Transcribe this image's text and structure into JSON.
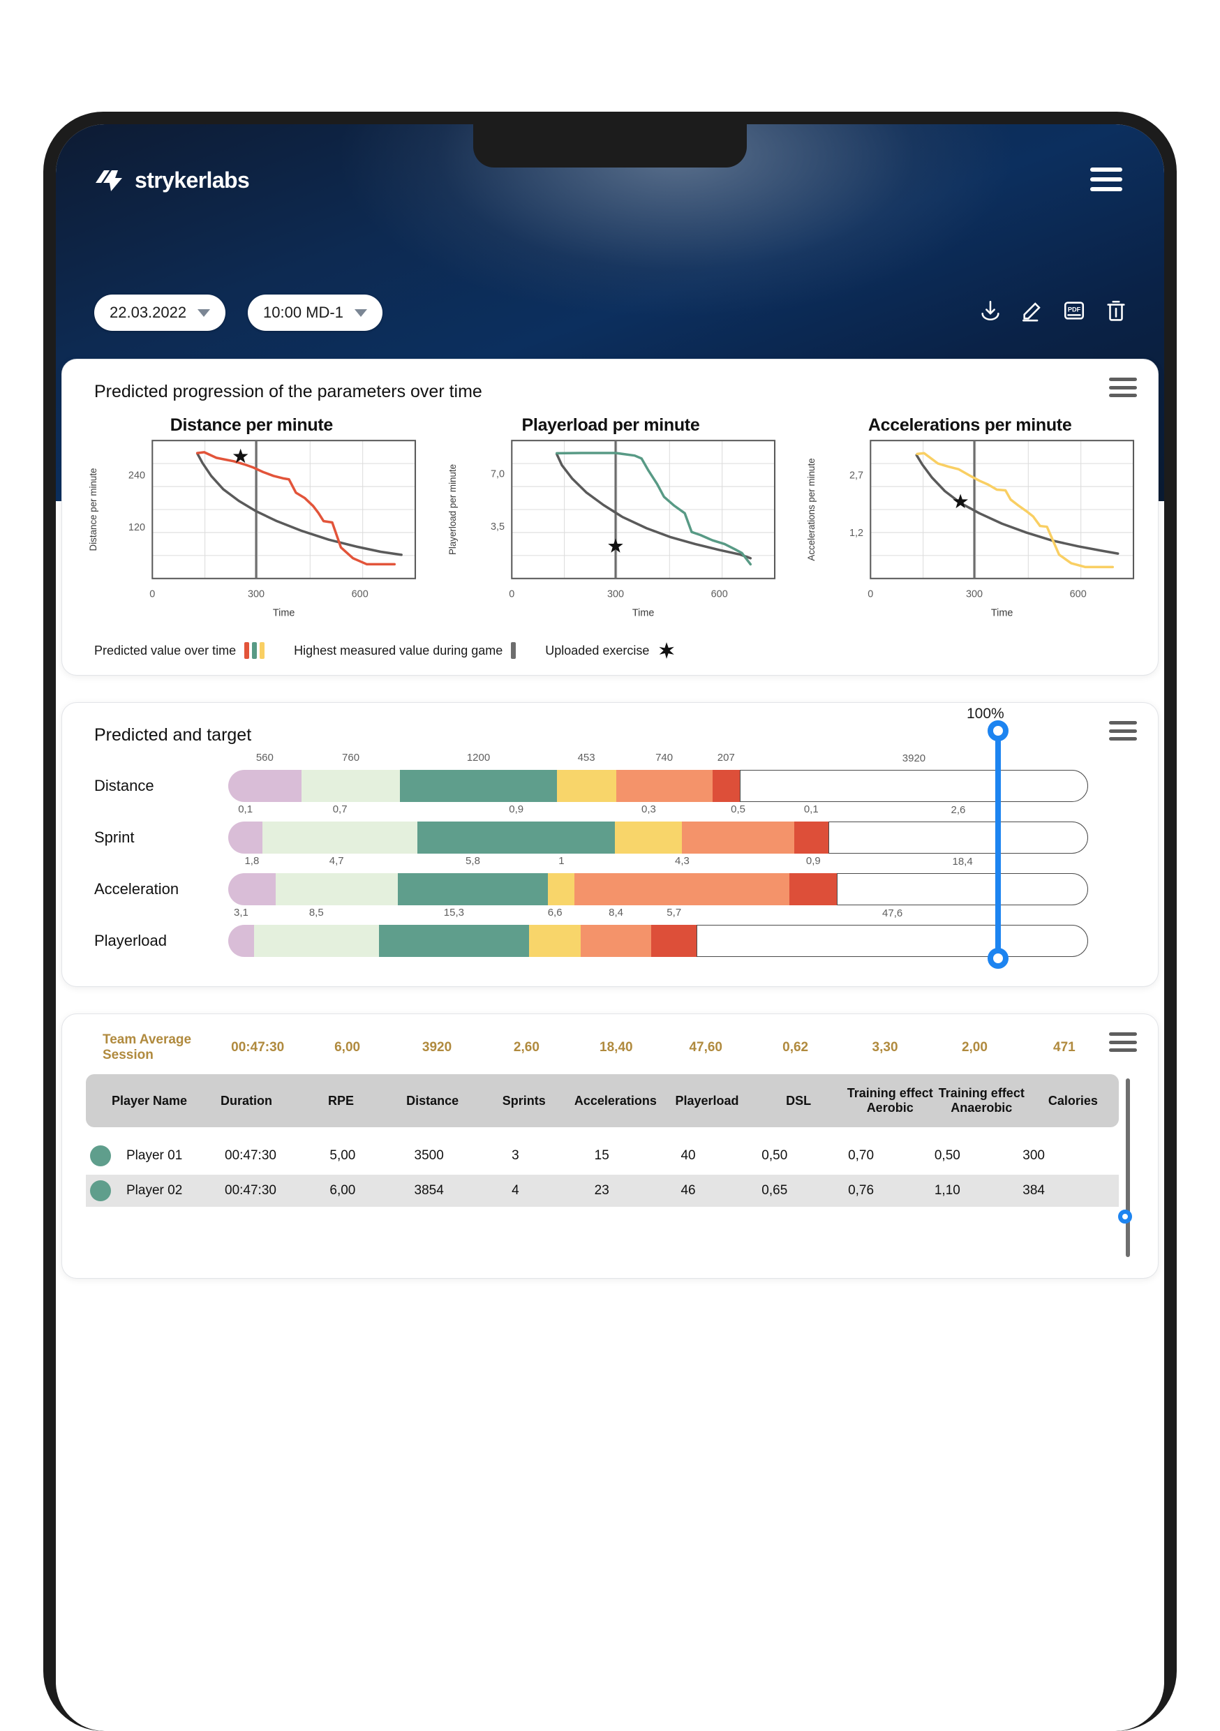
{
  "brand": {
    "name": "strykerlabs",
    "logo_icon": "lightning-bolt-icon"
  },
  "header": {
    "menu_icon": "hamburger-menu-icon",
    "date_select": "22.03.2022",
    "session_select": "10:00 MD-1",
    "toolbar": [
      {
        "name": "download-icon",
        "label": "Download"
      },
      {
        "name": "edit-pencil-icon",
        "label": "Edit"
      },
      {
        "name": "pdf-export-icon",
        "label": "PDF"
      },
      {
        "name": "trash-delete-icon",
        "label": "Delete"
      }
    ]
  },
  "charts_card": {
    "title": "Predicted progression of the parameters over time",
    "menu_icon": "hamburger-menu-icon",
    "legend": [
      {
        "label": "Predicted value over time",
        "icon": "three-color-bars-icon"
      },
      {
        "label": "Highest measured value during game",
        "icon": "grey-bar-icon"
      },
      {
        "label": "Uploaded exercise",
        "icon": "star-icon"
      }
    ]
  },
  "chart_data": [
    {
      "type": "line",
      "title": "Distance per minute",
      "xlabel": "Time",
      "ylabel": "Distance per minute",
      "xticks": [
        0,
        300,
        600
      ],
      "yticks": [
        120,
        240
      ],
      "xlim": [
        0,
        760
      ],
      "ylim": [
        0,
        320
      ],
      "grid": true,
      "marker_x": 300,
      "star": {
        "x": 255,
        "y": 283
      },
      "series": [
        {
          "name": "Predicted value over time",
          "color": "#e2543a",
          "x": [
            130,
            150,
            185,
            210,
            235,
            265,
            290,
            320,
            350,
            380,
            395,
            415,
            440,
            465,
            480,
            495,
            520,
            545,
            580,
            620,
            700
          ],
          "y": [
            291,
            293,
            280,
            276,
            272,
            265,
            258,
            247,
            238,
            232,
            230,
            199,
            187,
            168,
            152,
            133,
            130,
            72,
            47,
            33,
            33
          ]
        },
        {
          "name": "Highest measured value during game",
          "color": "#5a5a5a",
          "x": [
            130,
            145,
            170,
            205,
            250,
            300,
            360,
            430,
            510,
            590,
            660,
            720
          ],
          "y": [
            290,
            268,
            238,
            207,
            180,
            156,
            133,
            111,
            90,
            74,
            62,
            55
          ]
        }
      ]
    },
    {
      "type": "line",
      "title": "Playerload per minute",
      "xlabel": "Time",
      "ylabel": "Playerload per minute",
      "xticks": [
        0,
        300,
        600
      ],
      "yticks": [
        3.5,
        7.0
      ],
      "ytick_labels": [
        "3,5",
        "7,0"
      ],
      "xlim": [
        0,
        760
      ],
      "ylim": [
        0,
        9.2
      ],
      "grid": true,
      "marker_x": 300,
      "star": {
        "x": 300,
        "y": 2.15
      },
      "series": [
        {
          "name": "Predicted value over time",
          "color": "#589a85",
          "x": [
            130,
            200,
            300,
            355,
            375,
            395,
            420,
            440,
            470,
            500,
            520,
            545,
            580,
            615,
            645,
            665,
            690
          ],
          "y": [
            8.35,
            8.37,
            8.37,
            8.2,
            8.0,
            7.2,
            6.3,
            5.45,
            4.85,
            4.35,
            3.1,
            2.9,
            2.55,
            2.3,
            1.95,
            1.7,
            0.95
          ]
        },
        {
          "name": "Highest measured value during game",
          "color": "#5a5a5a",
          "x": [
            130,
            145,
            175,
            215,
            265,
            320,
            390,
            460,
            530,
            600,
            660,
            690
          ],
          "y": [
            8.3,
            7.55,
            6.65,
            5.75,
            4.9,
            4.1,
            3.35,
            2.75,
            2.3,
            1.9,
            1.6,
            1.35
          ]
        }
      ]
    },
    {
      "type": "line",
      "title": "Accelerations per minute",
      "xlabel": "Time",
      "ylabel": "Accelerations per minute",
      "xticks": [
        0,
        300,
        600
      ],
      "yticks": [
        1.2,
        2.7
      ],
      "ytick_labels": [
        "1,2",
        "2,7"
      ],
      "xlim": [
        0,
        760
      ],
      "ylim": [
        0,
        3.6
      ],
      "grid": true,
      "marker_x": 300,
      "star": {
        "x": 260,
        "y": 2.0
      },
      "series": [
        {
          "name": "Predicted value over time",
          "color": "#f9cf63",
          "x": [
            135,
            155,
            195,
            225,
            255,
            290,
            315,
            340,
            365,
            390,
            405,
            425,
            450,
            470,
            490,
            510,
            545,
            580,
            620,
            700
          ],
          "y": [
            3.25,
            3.27,
            3.0,
            2.92,
            2.85,
            2.67,
            2.55,
            2.45,
            2.32,
            2.3,
            2.06,
            1.92,
            1.76,
            1.62,
            1.37,
            1.35,
            0.62,
            0.4,
            0.3,
            0.3
          ]
        },
        {
          "name": "Highest measured value during game",
          "color": "#5a5a5a",
          "x": [
            133,
            150,
            178,
            215,
            260,
            315,
            380,
            450,
            525,
            600,
            665,
            715
          ],
          "y": [
            3.22,
            2.97,
            2.63,
            2.28,
            1.97,
            1.7,
            1.43,
            1.2,
            0.99,
            0.84,
            0.73,
            0.65
          ]
        }
      ]
    }
  ],
  "target_card": {
    "title": "Predicted and target",
    "menu_icon": "hamburger-menu-icon",
    "percent_label": "100%",
    "slider_name": "target-percent-slider",
    "colors": {
      "lilac": "#d9bdd7",
      "pale_green": "#e4f0dd",
      "green": "#5f9e8c",
      "yellow": "#f8d56a",
      "orange": "#f4936a",
      "red": "#dd4f39",
      "empty": "#ffffff"
    },
    "rows": [
      {
        "label": "Distance",
        "segments": [
          {
            "value": "560",
            "color": "lilac",
            "width": 8.5
          },
          {
            "value": "760",
            "color": "pale_green",
            "width": 11.5
          },
          {
            "value": "1200",
            "color": "green",
            "width": 18.2
          },
          {
            "value": "453",
            "color": "yellow",
            "width": 6.9
          },
          {
            "value": "740",
            "color": "orange",
            "width": 11.2
          },
          {
            "value": "207",
            "color": "red",
            "width": 3.2
          },
          {
            "value": "3920",
            "color": "empty",
            "width": 40.5
          }
        ]
      },
      {
        "label": "Sprint",
        "segments": [
          {
            "value": "0,1",
            "color": "lilac",
            "width": 4.0
          },
          {
            "value": "0,7",
            "color": "pale_green",
            "width": 18.0
          },
          {
            "value": "0,9",
            "color": "green",
            "width": 23.0
          },
          {
            "value": "0,3",
            "color": "yellow",
            "width": 7.8
          },
          {
            "value": "0,5",
            "color": "orange",
            "width": 13.0
          },
          {
            "value": "0,1",
            "color": "red",
            "width": 4.0
          },
          {
            "value": "2,6",
            "color": "empty",
            "width": 30.2
          }
        ]
      },
      {
        "label": "Acceleration",
        "segments": [
          {
            "value": "1,8",
            "color": "lilac",
            "width": 5.5
          },
          {
            "value": "4,7",
            "color": "pale_green",
            "width": 14.2
          },
          {
            "value": "5,8",
            "color": "green",
            "width": 17.5
          },
          {
            "value": "1",
            "color": "yellow",
            "width": 3.1
          },
          {
            "value": "4,3",
            "color": "orange",
            "width": 25.0
          },
          {
            "value": "0,9",
            "color": "red",
            "width": 5.5
          },
          {
            "value": "18,4",
            "color": "empty",
            "width": 29.2
          }
        ]
      },
      {
        "label": "Playerload",
        "segments": [
          {
            "value": "3,1",
            "color": "lilac",
            "width": 3.0
          },
          {
            "value": "8,5",
            "color": "pale_green",
            "width": 14.5
          },
          {
            "value": "15,3",
            "color": "green",
            "width": 17.5
          },
          {
            "value": "6,6",
            "color": "yellow",
            "width": 6.0
          },
          {
            "value": "8,4",
            "color": "orange",
            "width": 8.2
          },
          {
            "value": "5,7",
            "color": "red",
            "width": 5.3
          },
          {
            "value": "47,6",
            "color": "empty",
            "width": 45.5
          }
        ]
      }
    ]
  },
  "table_card": {
    "menu_icon": "hamburger-menu-icon",
    "average_row": {
      "label": "Team Average Session",
      "values": [
        "00:47:30",
        "6,00",
        "3920",
        "2,60",
        "18,40",
        "47,60",
        "0,62",
        "3,30",
        "2,00",
        "471"
      ]
    },
    "columns": [
      "Player Name",
      "Duration",
      "RPE",
      "Distance",
      "Sprints",
      "Accelerations",
      "Playerload",
      "DSL",
      "Training effect Aerobic",
      "Training effect Anaerobic",
      "Calories"
    ],
    "rows": [
      {
        "name": "Player 01",
        "dot_color": "#5f9e8c",
        "values": [
          "00:47:30",
          "5,00",
          "3500",
          "3",
          "15",
          "40",
          "0,50",
          "0,70",
          "0,50",
          "300"
        ]
      },
      {
        "name": "Player 02",
        "dot_color": "#5f9e8c",
        "values": [
          "00:47:30",
          "6,00",
          "3854",
          "4",
          "23",
          "46",
          "0,65",
          "0,76",
          "1,10",
          "384"
        ]
      }
    ]
  }
}
